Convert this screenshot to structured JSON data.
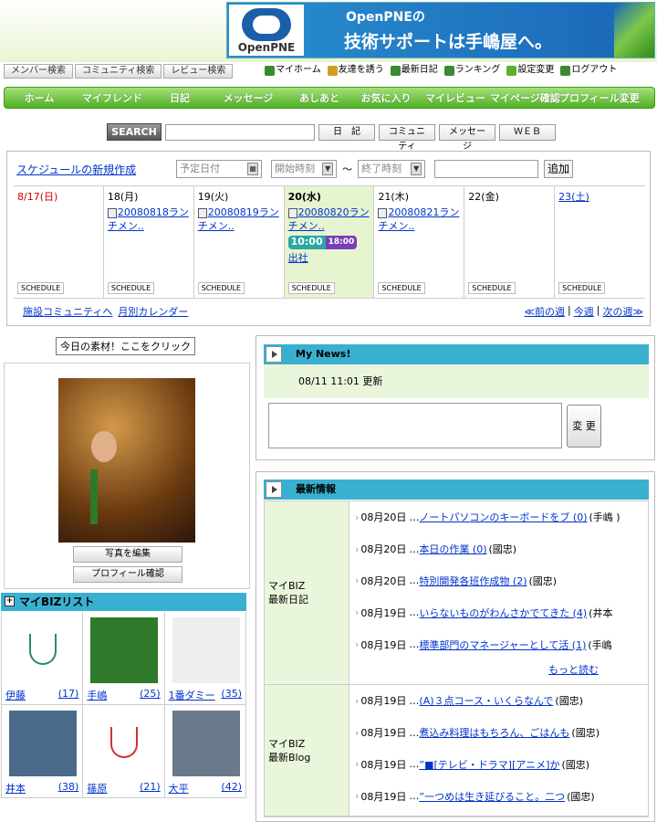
{
  "header": {
    "banner_logo": "OpenPNE",
    "banner_line1": "OpenPNEの",
    "banner_line2": "技術サポートは手嶋屋へ。"
  },
  "search_tabs": [
    "メンバー検索",
    "コミュニティ検索",
    "レビュー検索"
  ],
  "util_links": [
    {
      "label": "マイホーム",
      "color": "#3a8a30"
    },
    {
      "label": "友達を誘う",
      "color": "#d0a020"
    },
    {
      "label": "最新日記",
      "color": "#3a8a30"
    },
    {
      "label": "ランキング",
      "color": "#3a8a30"
    },
    {
      "label": "設定変更",
      "color": "#5ab030"
    },
    {
      "label": "ログアウト",
      "color": "#3a8a30"
    }
  ],
  "global_nav": [
    "ホーム",
    "マイフレンド",
    "日記",
    "メッセージ",
    "あしあと",
    "お気に入り",
    "マイレビュー",
    "マイページ確認",
    "プロフィール変更"
  ],
  "search": {
    "button": "SEARCH",
    "options": [
      "日　記",
      "コミュニティ",
      "メッセージ",
      "ＷＥＢ"
    ]
  },
  "schedule": {
    "create_link": "スケジュールの新規作成",
    "date_placeholder": "予定日付",
    "start_time": "開始時刻",
    "tilde": "〜",
    "end_time": "終了時刻",
    "add_button": "追加",
    "days": [
      {
        "label": "8/17(日)",
        "color": "#cc0000",
        "bold": false,
        "events": [],
        "badge": null
      },
      {
        "label": "18(月)",
        "color": "#000000",
        "bold": false,
        "events": [
          "20080818ランチメン.."
        ],
        "badge": null
      },
      {
        "label": "19(火)",
        "color": "#000000",
        "bold": false,
        "events": [
          "20080819ランチメン.."
        ],
        "badge": null
      },
      {
        "label": "20(水)",
        "color": "#000000",
        "bold": true,
        "events": [
          "20080820ランチメン.."
        ],
        "badge": {
          "start": "10:00",
          "end": "18:00",
          "title": "出社"
        }
      },
      {
        "label": "21(木)",
        "color": "#000000",
        "bold": false,
        "events": [
          "20080821ランチメン.."
        ],
        "badge": null
      },
      {
        "label": "22(金)",
        "color": "#000000",
        "bold": false,
        "events": [],
        "badge": null
      },
      {
        "label": "23(土)",
        "color": "#0033cc",
        "bold": false,
        "events": [],
        "badge": null
      }
    ],
    "schedule_btn": "SCHEDULE",
    "foot_left": [
      "施設コミュニティへ",
      "月別カレンダー"
    ],
    "foot_right": [
      "≪前の週",
      "今週",
      "次の週≫"
    ],
    "sep": "|"
  },
  "material_button": "今日の素材！ここをクリック",
  "profile": {
    "edit_photo": "写真を編集",
    "check_profile": "プロフィール確認"
  },
  "biz_list": {
    "title": "マイBIZリスト",
    "members": [
      {
        "name": "伊藤",
        "count": "(17)"
      },
      {
        "name": "手嶋",
        "count": "(25)"
      },
      {
        "name": "1番ダミー",
        "count": "(35)"
      },
      {
        "name": "井本",
        "count": "(38)"
      },
      {
        "name": "篠原",
        "count": "(21)"
      },
      {
        "name": "大平",
        "count": "(42)"
      }
    ]
  },
  "mynews": {
    "title": "My News!",
    "updated": "08/11 11:01 更新",
    "change_button": "変 更"
  },
  "latest": {
    "title": "最新情報",
    "more": "もっと読む",
    "marker": "›",
    "dots": "…",
    "sections": [
      {
        "category_line1": "マイBIZ",
        "category_line2": "最新日記",
        "items": [
          {
            "date": "08月20日",
            "title": "ノートパソコンのキーボードをブ (0)",
            "author": "(手嶋 )"
          },
          {
            "date": "08月20日",
            "title": "本日の作業 (0)",
            "author": "(國忠)"
          },
          {
            "date": "08月20日",
            "title": "特別開発各班作成物 (2)",
            "author": "(國忠)"
          },
          {
            "date": "08月19日",
            "title": "いらないものがわんさかでてきた (4)",
            "author": "(井本"
          },
          {
            "date": "08月19日",
            "title": "標準部門のマネージャーとして活 (1)",
            "author": "(手嶋"
          }
        ]
      },
      {
        "category_line1": "マイBIZ",
        "category_line2": "最新Blog",
        "items": [
          {
            "date": "08月19日",
            "title": "(A)３点コース・いくらなんで",
            "author": "(國忠)"
          },
          {
            "date": "08月19日",
            "title": "煮込み料理はもちろん、ごはんも",
            "author": "(國忠)"
          },
          {
            "date": "08月19日",
            "title": "”■[テレビ・ドラマ][アニメ]か",
            "author": "(國忠)"
          },
          {
            "date": "08月19日",
            "title": "”一つめは生き延びること。二つ",
            "author": "(國忠)"
          }
        ]
      }
    ]
  }
}
